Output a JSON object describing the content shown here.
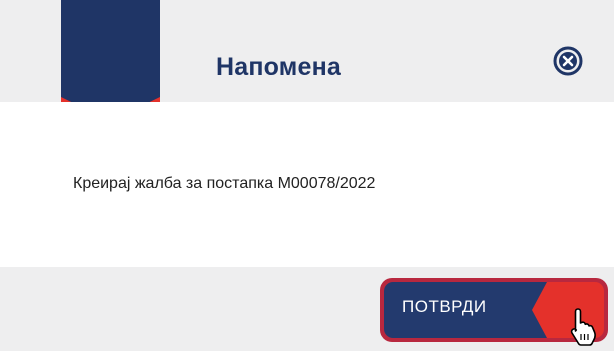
{
  "dialog": {
    "title": "Напомена",
    "message": "Креирај жалба за постапка M00078/2022",
    "close_icon": "close-circle-icon",
    "confirm_label": "ПОТВРДИ"
  },
  "colors": {
    "header_bg": "#eeeeef",
    "bookmark_blue": "#1f3566",
    "bookmark_red": "#e4312b",
    "title_color": "#1f3566",
    "button_blue": "#233a6e",
    "button_red": "#e4312b",
    "button_border": "#b8283f"
  },
  "cursor": "hand-pointer-icon"
}
